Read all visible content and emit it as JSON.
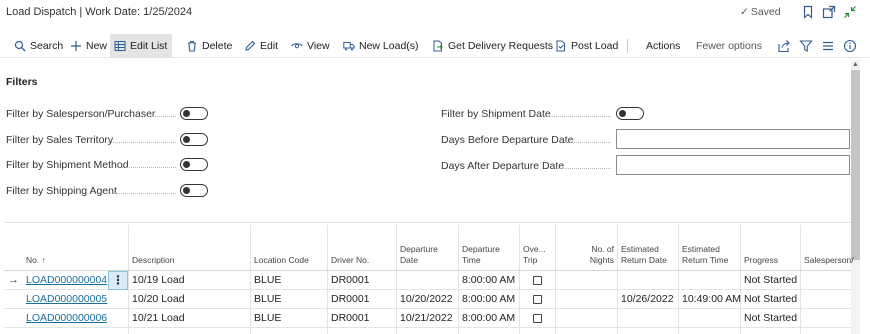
{
  "page": {
    "title": "Load Dispatch | Work Date: 1/25/2024",
    "status": "Saved"
  },
  "icons": {
    "bookmark": "bookmark-icon",
    "popout": "open-new-window-icon",
    "collapse": "collapse-icon"
  },
  "toolbar": {
    "search": "Search",
    "new": "New",
    "edit_list": "Edit List",
    "delete": "Delete",
    "edit": "Edit",
    "view": "View",
    "new_loads": "New Load(s)",
    "get_delivery_requests": "Get Delivery Requests",
    "post_load": "Post Load",
    "actions": "Actions",
    "fewer_options": "Fewer options"
  },
  "filters": {
    "heading": "Filters",
    "left": [
      "Filter by Salesperson/Purchaser",
      "Filter by Sales Territory",
      "Filter by Shipment Method",
      "Filter by Shipping Agent"
    ],
    "shipment_date_label": "Filter by Shipment Date",
    "days_before_label": "Days Before Departure Date",
    "days_before_value": "",
    "days_after_label": "Days After Departure Date",
    "days_after_value": ""
  },
  "table": {
    "headers": {
      "no": "No. ↑",
      "description": "Description",
      "location_code": "Location Code",
      "driver_no": "Driver No.",
      "departure_date_1": "Departure",
      "departure_date_2": "Date",
      "departure_time_1": "Departure",
      "departure_time_2": "Time",
      "overtrip_1": "Ove...",
      "overtrip_2": "Trip",
      "nights_1": "No. of",
      "nights_2": "Nights",
      "est_return_date_1": "Estimated",
      "est_return_date_2": "Return Date",
      "est_return_time_1": "Estimated",
      "est_return_time_2": "Return Time",
      "progress": "Progress",
      "salesperson": "Salesperson/"
    },
    "rows": [
      {
        "no": "LOAD000000004",
        "description": "10/19 Load",
        "location": "BLUE",
        "driver": "DR0001",
        "dep_date": "",
        "dep_time": "8:00:00 AM",
        "overtrip": false,
        "nights": "",
        "ret_date": "",
        "ret_time": "",
        "progress": "Not Started"
      },
      {
        "no": "LOAD000000005",
        "description": "10/20 Load",
        "location": "BLUE",
        "driver": "DR0001",
        "dep_date": "10/20/2022",
        "dep_time": "8:00:00 AM",
        "overtrip": false,
        "nights": "",
        "ret_date": "10/26/2022",
        "ret_time": "10:49:00 AM",
        "progress": "Not Started"
      },
      {
        "no": "LOAD000000006",
        "description": "10/21 Load",
        "location": "BLUE",
        "driver": "DR0001",
        "dep_date": "10/21/2022",
        "dep_time": "8:00:00 AM",
        "overtrip": false,
        "nights": "",
        "ret_date": "",
        "ret_time": "",
        "progress": "Not Started"
      }
    ]
  }
}
